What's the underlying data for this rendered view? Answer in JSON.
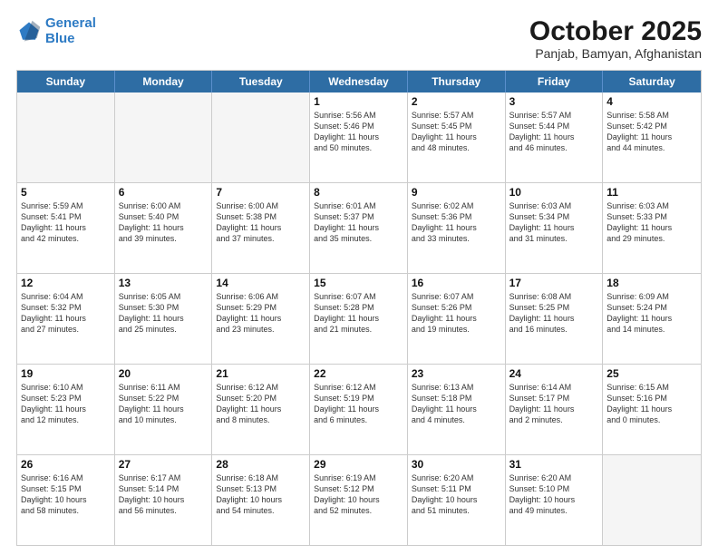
{
  "logo": {
    "line1": "General",
    "line2": "Blue"
  },
  "title": "October 2025",
  "subtitle": "Panjab, Bamyan, Afghanistan",
  "days_of_week": [
    "Sunday",
    "Monday",
    "Tuesday",
    "Wednesday",
    "Thursday",
    "Friday",
    "Saturday"
  ],
  "weeks": [
    [
      {
        "day": "",
        "info": ""
      },
      {
        "day": "",
        "info": ""
      },
      {
        "day": "",
        "info": ""
      },
      {
        "day": "1",
        "info": "Sunrise: 5:56 AM\nSunset: 5:46 PM\nDaylight: 11 hours\nand 50 minutes."
      },
      {
        "day": "2",
        "info": "Sunrise: 5:57 AM\nSunset: 5:45 PM\nDaylight: 11 hours\nand 48 minutes."
      },
      {
        "day": "3",
        "info": "Sunrise: 5:57 AM\nSunset: 5:44 PM\nDaylight: 11 hours\nand 46 minutes."
      },
      {
        "day": "4",
        "info": "Sunrise: 5:58 AM\nSunset: 5:42 PM\nDaylight: 11 hours\nand 44 minutes."
      }
    ],
    [
      {
        "day": "5",
        "info": "Sunrise: 5:59 AM\nSunset: 5:41 PM\nDaylight: 11 hours\nand 42 minutes."
      },
      {
        "day": "6",
        "info": "Sunrise: 6:00 AM\nSunset: 5:40 PM\nDaylight: 11 hours\nand 39 minutes."
      },
      {
        "day": "7",
        "info": "Sunrise: 6:00 AM\nSunset: 5:38 PM\nDaylight: 11 hours\nand 37 minutes."
      },
      {
        "day": "8",
        "info": "Sunrise: 6:01 AM\nSunset: 5:37 PM\nDaylight: 11 hours\nand 35 minutes."
      },
      {
        "day": "9",
        "info": "Sunrise: 6:02 AM\nSunset: 5:36 PM\nDaylight: 11 hours\nand 33 minutes."
      },
      {
        "day": "10",
        "info": "Sunrise: 6:03 AM\nSunset: 5:34 PM\nDaylight: 11 hours\nand 31 minutes."
      },
      {
        "day": "11",
        "info": "Sunrise: 6:03 AM\nSunset: 5:33 PM\nDaylight: 11 hours\nand 29 minutes."
      }
    ],
    [
      {
        "day": "12",
        "info": "Sunrise: 6:04 AM\nSunset: 5:32 PM\nDaylight: 11 hours\nand 27 minutes."
      },
      {
        "day": "13",
        "info": "Sunrise: 6:05 AM\nSunset: 5:30 PM\nDaylight: 11 hours\nand 25 minutes."
      },
      {
        "day": "14",
        "info": "Sunrise: 6:06 AM\nSunset: 5:29 PM\nDaylight: 11 hours\nand 23 minutes."
      },
      {
        "day": "15",
        "info": "Sunrise: 6:07 AM\nSunset: 5:28 PM\nDaylight: 11 hours\nand 21 minutes."
      },
      {
        "day": "16",
        "info": "Sunrise: 6:07 AM\nSunset: 5:26 PM\nDaylight: 11 hours\nand 19 minutes."
      },
      {
        "day": "17",
        "info": "Sunrise: 6:08 AM\nSunset: 5:25 PM\nDaylight: 11 hours\nand 16 minutes."
      },
      {
        "day": "18",
        "info": "Sunrise: 6:09 AM\nSunset: 5:24 PM\nDaylight: 11 hours\nand 14 minutes."
      }
    ],
    [
      {
        "day": "19",
        "info": "Sunrise: 6:10 AM\nSunset: 5:23 PM\nDaylight: 11 hours\nand 12 minutes."
      },
      {
        "day": "20",
        "info": "Sunrise: 6:11 AM\nSunset: 5:22 PM\nDaylight: 11 hours\nand 10 minutes."
      },
      {
        "day": "21",
        "info": "Sunrise: 6:12 AM\nSunset: 5:20 PM\nDaylight: 11 hours\nand 8 minutes."
      },
      {
        "day": "22",
        "info": "Sunrise: 6:12 AM\nSunset: 5:19 PM\nDaylight: 11 hours\nand 6 minutes."
      },
      {
        "day": "23",
        "info": "Sunrise: 6:13 AM\nSunset: 5:18 PM\nDaylight: 11 hours\nand 4 minutes."
      },
      {
        "day": "24",
        "info": "Sunrise: 6:14 AM\nSunset: 5:17 PM\nDaylight: 11 hours\nand 2 minutes."
      },
      {
        "day": "25",
        "info": "Sunrise: 6:15 AM\nSunset: 5:16 PM\nDaylight: 11 hours\nand 0 minutes."
      }
    ],
    [
      {
        "day": "26",
        "info": "Sunrise: 6:16 AM\nSunset: 5:15 PM\nDaylight: 10 hours\nand 58 minutes."
      },
      {
        "day": "27",
        "info": "Sunrise: 6:17 AM\nSunset: 5:14 PM\nDaylight: 10 hours\nand 56 minutes."
      },
      {
        "day": "28",
        "info": "Sunrise: 6:18 AM\nSunset: 5:13 PM\nDaylight: 10 hours\nand 54 minutes."
      },
      {
        "day": "29",
        "info": "Sunrise: 6:19 AM\nSunset: 5:12 PM\nDaylight: 10 hours\nand 52 minutes."
      },
      {
        "day": "30",
        "info": "Sunrise: 6:20 AM\nSunset: 5:11 PM\nDaylight: 10 hours\nand 51 minutes."
      },
      {
        "day": "31",
        "info": "Sunrise: 6:20 AM\nSunset: 5:10 PM\nDaylight: 10 hours\nand 49 minutes."
      },
      {
        "day": "",
        "info": ""
      }
    ]
  ]
}
